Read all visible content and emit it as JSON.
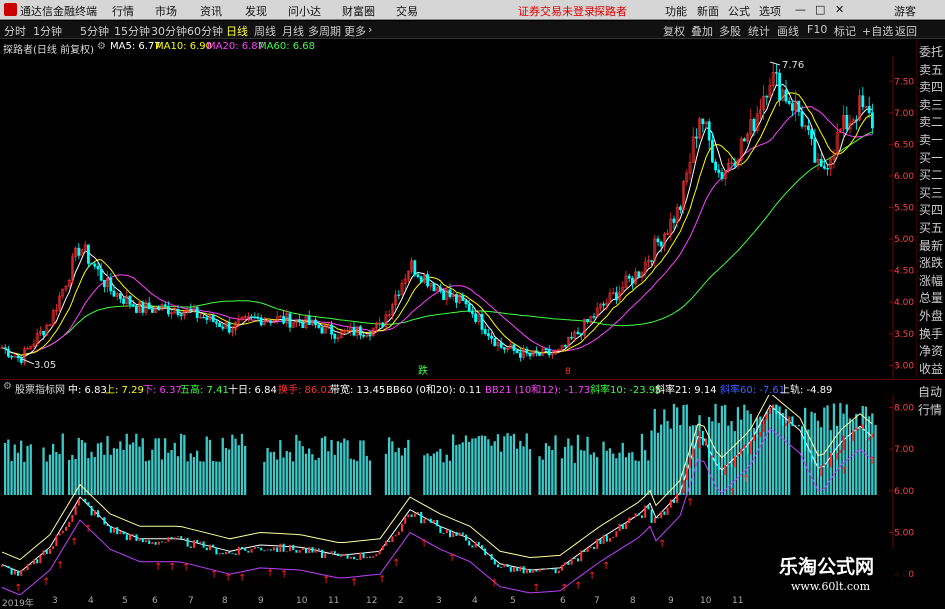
{
  "menubar": {
    "app_title": "通达信金融终端",
    "menus": [
      "行情",
      "市场",
      "资讯",
      "发现",
      "问小达",
      "财富圈",
      "交易"
    ],
    "login_status": "证券交易未登录",
    "stock_name": "探路者",
    "right_items": [
      "功能",
      "新面",
      "公式",
      "选项"
    ],
    "guest": "游客"
  },
  "toolbar": {
    "periods": [
      "分时",
      "1分钟",
      "5分钟",
      "15分钟",
      "30分钟",
      "60分钟",
      "日线",
      "周线",
      "月线",
      "多周期",
      "更多"
    ],
    "active_period": "日线",
    "right_tools": [
      "复权",
      "叠加",
      "多股",
      "统计",
      "画线",
      "F10",
      "标记",
      "+自选",
      "返回"
    ]
  },
  "info": {
    "title": "探路者(日线 前复权)",
    "ma": [
      {
        "label": "MA5: 6.77",
        "color": "#ffffff"
      },
      {
        "label": "MA10: 6.90",
        "color": "#ffff00"
      },
      {
        "label": "MA20: 6.87",
        "color": "#ff40ff"
      },
      {
        "label": "MA60: 6.68",
        "color": "#40ff40"
      }
    ]
  },
  "main_axis": {
    "ticks": [
      "7.50",
      "7.00",
      "6.50",
      "6.00",
      "5.50",
      "5.00",
      "4.50",
      "4.00",
      "3.50",
      "3.00"
    ]
  },
  "annotations": {
    "high": "7.76",
    "low": "3.05"
  },
  "side_panel": {
    "items": [
      "委托",
      "卖五",
      "卖四",
      "卖三",
      "卖二",
      "卖一",
      "买一",
      "买二",
      "买三",
      "买四",
      "买五",
      "最新",
      "涨跌",
      "涨幅",
      "总量",
      "外盘",
      "换手",
      "净资",
      "收益"
    ]
  },
  "side_panel2": {
    "items": [
      "自动",
      "行情"
    ]
  },
  "indicator": {
    "name": "股票指标网",
    "values": [
      {
        "label": "中: 6.83",
        "color": "#ffffff"
      },
      {
        "label": "上: 7.29",
        "color": "#ffff00"
      },
      {
        "label": "下: 6.37",
        "color": "#ff40ff"
      },
      {
        "label": "五高: 7.41",
        "color": "#40ff40"
      },
      {
        "label": "十日: 6.84",
        "color": "#ffffff"
      },
      {
        "label": "换手: 86.02",
        "color": "#ff3030"
      },
      {
        "label": "带宽: 13.45",
        "color": "#ffffff"
      },
      {
        "label": "BB60 (0和20): 0.11",
        "color": "#ffffff"
      },
      {
        "label": "BB21 (10和12): -1.73",
        "color": "#ff40ff"
      },
      {
        "label": "斜率10: -23.95",
        "color": "#40ff40"
      },
      {
        "label": "斜率21: 9.14",
        "color": "#ffffff"
      },
      {
        "label": "斜率60: -7.61",
        "color": "#4060ff"
      },
      {
        "label": "上轨: -4.89",
        "color": "#ffffff"
      }
    ],
    "axis_ticks": [
      "8.00",
      "7.00",
      "6.00",
      "5.00",
      "4.00"
    ]
  },
  "markers": {
    "fall": "跌",
    "up": "8"
  },
  "xaxis": {
    "labels": [
      "2019年",
      "3",
      "4",
      "5",
      "6",
      "7",
      "8",
      "9",
      "10",
      "11",
      "12",
      "2",
      "3",
      "4",
      "5",
      "6",
      "7",
      "8",
      "9",
      "10",
      "11"
    ]
  },
  "watermark": {
    "title": "乐淘公式网",
    "url": "www.60lt.com"
  },
  "colors": {
    "up": "#ff3232",
    "down": "#00ffff",
    "ma5": "#ffffff",
    "ma10": "#ffff00",
    "ma20": "#ff40ff",
    "ma60": "#40ff40",
    "histogram": "#3ec8c8"
  }
}
